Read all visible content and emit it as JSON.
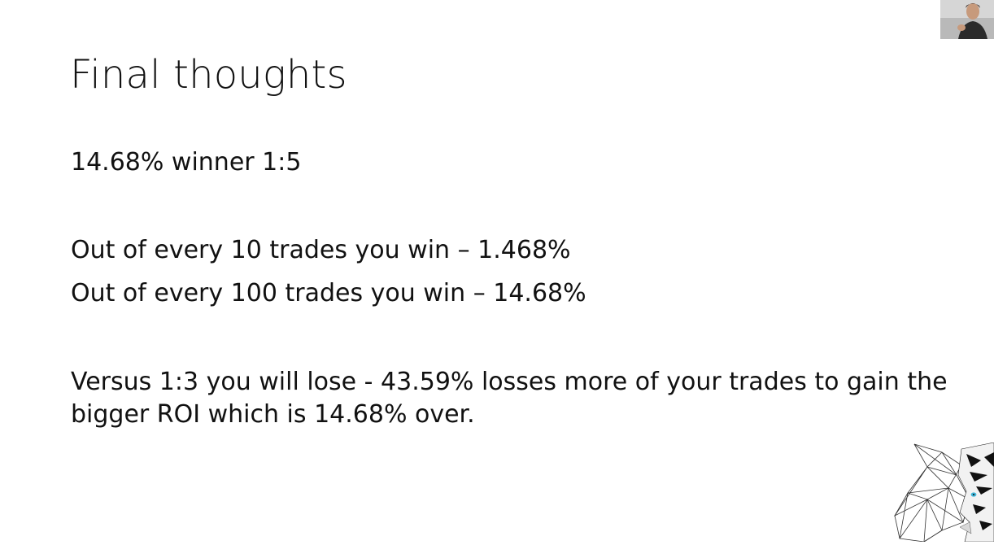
{
  "slide": {
    "title": "Final thoughts",
    "lines": [
      "14.68% winner 1:5",
      "Out of every 10 trades you win – 1.468%",
      "Out of every 100 trades you win – 14.68%"
    ],
    "paragraph": [
      "Versus 1:3 you will lose - 43.59% losses more of your trades to gain the",
      "bigger ROI which is 14.68% over."
    ]
  },
  "overlay": {
    "webcam_icon": "presenter-webcam",
    "logo_icon": "geometric-tiger-logo"
  }
}
